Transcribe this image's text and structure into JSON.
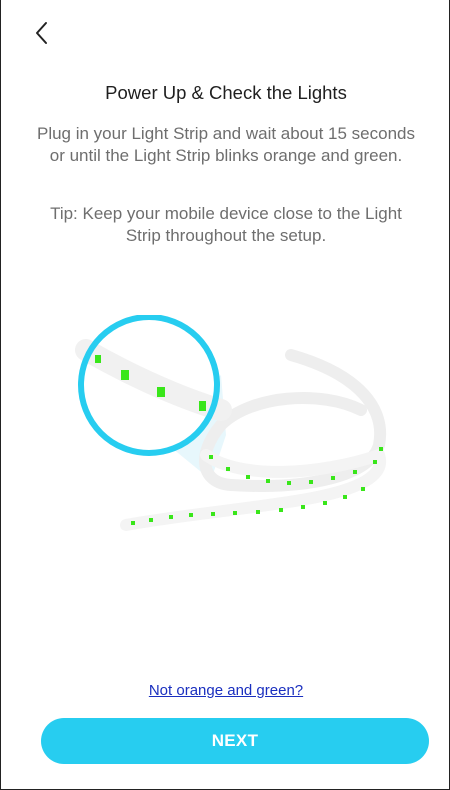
{
  "header": {
    "back_icon": "chevron-left-icon"
  },
  "content": {
    "title": "Power Up & Check the Lights",
    "instruction": "Plug in your Light Strip and wait about 15 seconds or until the Light Strip blinks orange and green.",
    "tip": "Tip: Keep your mobile device close to the Light Strip throughout the setup."
  },
  "illustration": {
    "icon": "light-strip-illustration",
    "accent_color": "#27cdf0",
    "led_color": "#39e61a"
  },
  "footer": {
    "help_link": "Not orange and green?",
    "next_label": "NEXT",
    "next_color": "#27cdf0"
  }
}
